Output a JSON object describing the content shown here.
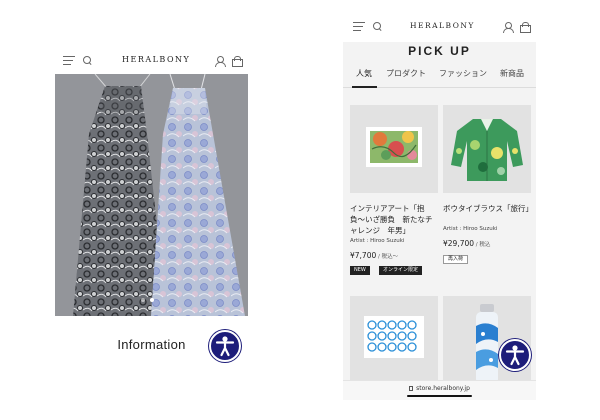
{
  "left_screen": {
    "header": {
      "logo": "HERALBONY",
      "menu_icon": "menu-icon",
      "search_icon": "search-icon",
      "account_icon": "user-icon",
      "cart_icon": "bag-icon"
    },
    "hero": {
      "slide_count": 2,
      "active_slide": 2
    },
    "section_title": "Information",
    "accessibility_icon": "accessibility-icon"
  },
  "right_screen": {
    "header": {
      "logo": "HERALBONY",
      "menu_icon": "menu-icon",
      "search_icon": "search-icon",
      "account_icon": "user-icon",
      "cart_icon": "bag-icon"
    },
    "page_title": "PICK UP",
    "tabs": [
      {
        "label": "人気",
        "active": true
      },
      {
        "label": "プロダクト",
        "active": false
      },
      {
        "label": "ファッション",
        "active": false
      },
      {
        "label": "新商品",
        "active": false
      }
    ],
    "products": [
      {
        "name": "インテリアアート「抱負〜いざ勝負　新たなチャレンジ　年男」",
        "artist": "Artist : Hiroo Suzuki",
        "price": "¥7,700",
        "price_note": " / 税込〜",
        "badges": [
          {
            "label": "NEW",
            "style": "dark"
          },
          {
            "label": "オンライン限定",
            "style": "dark"
          }
        ]
      },
      {
        "name": "ボウタイブラウス「旅行」",
        "artist": "Artist : Hiroo Suzuki",
        "price": "¥29,700",
        "price_note": " / 税込",
        "badges": [
          {
            "label": "再入荷",
            "style": "light"
          }
        ]
      }
    ],
    "url": "store.heralbony.jp",
    "accessibility_icon": "accessibility-icon"
  },
  "colors": {
    "accessibility_button": "#1d1d7a",
    "background": "#f3f3f3",
    "badge_dark": "#222222"
  }
}
